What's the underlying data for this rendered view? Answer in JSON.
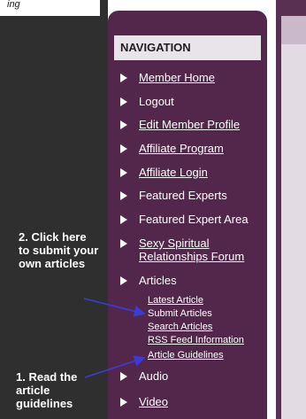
{
  "top_fragment": "ing",
  "navigation": {
    "header": "NAVIGATION",
    "items": [
      {
        "label": "Member Home",
        "underlined": true
      },
      {
        "label": "Logout",
        "underlined": false
      },
      {
        "label": "Edit Member Profile",
        "underlined": true
      },
      {
        "label": "Affiliate Program",
        "underlined": true
      },
      {
        "label": "Affiliate Login",
        "underlined": true
      },
      {
        "label": "Featured Experts",
        "underlined": false
      },
      {
        "label": "Featured Expert Area",
        "underlined": false
      },
      {
        "label": "Sexy Spiritual Relationships Forum",
        "underlined": true
      },
      {
        "label": "Articles",
        "underlined": false
      },
      {
        "label": "Audio",
        "underlined": false
      },
      {
        "label": "Video",
        "underlined": true
      }
    ],
    "articles_submenu": [
      "Latest Article",
      "Submit Articles",
      "Search Articles",
      "RSS Feed Information",
      "Article Guidelines"
    ]
  },
  "annotations": {
    "submit": "2. Click here to submit your own articles",
    "read": "1. Read the article guidelines"
  },
  "colors": {
    "sidebar": "#53274b",
    "dark_background": "#2f2f2f",
    "header_bg": "#e9e3ea",
    "arrow": "#3b3bd9"
  }
}
